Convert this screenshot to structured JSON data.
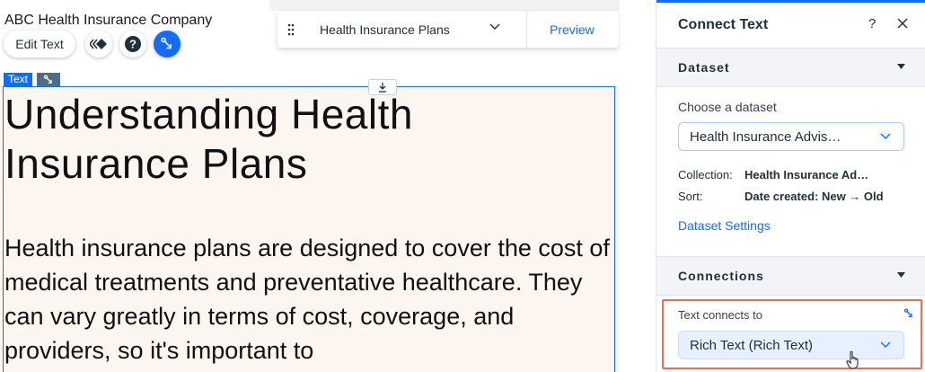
{
  "canvas": {
    "company_name": "ABC Health Insurance Company",
    "edit_text_label": "Edit Text",
    "text_tag_label": "Text",
    "heading": "Understanding Health Insurance Plans",
    "paragraph": "Health insurance plans are designed to cover the cost of medical treatments and preventative healthcare. They can vary greatly in terms of cost, coverage, and providers, so it's important to"
  },
  "toolbar": {
    "dataset_name": "Health Insurance Plans",
    "preview_label": "Preview"
  },
  "panel": {
    "title": "Connect Text",
    "help_label": "?",
    "dataset_section": {
      "label": "Dataset",
      "choose_label": "Choose a dataset",
      "selected_dataset": "Health Insurance Advis…",
      "collection_key": "Collection:",
      "collection_value": "Health Insurance Ad…",
      "sort_key": "Sort:",
      "sort_value": "Date created: New → Old",
      "settings_link": "Dataset Settings"
    },
    "connections_section": {
      "label": "Connections",
      "text_connects_label": "Text connects to",
      "selected_field": "Rich Text (Rich Text)"
    }
  },
  "colors": {
    "accent": "#116dff",
    "highlight": "#f06c4a",
    "canvas_bg": "#fdf5ef"
  }
}
